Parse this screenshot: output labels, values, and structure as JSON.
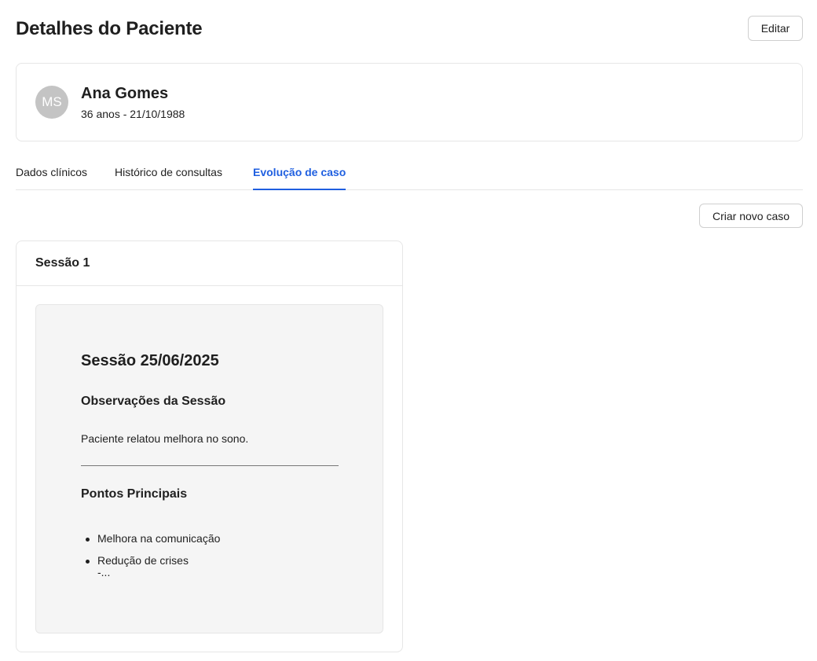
{
  "header": {
    "title": "Detalhes do Paciente",
    "edit_label": "Editar"
  },
  "patient": {
    "initials": "MS",
    "name": "Ana Gomes",
    "subtitle": "36 anos - 21/10/1988"
  },
  "tabs": [
    {
      "label": "Dados clínicos",
      "active": false
    },
    {
      "label": "Histórico de consultas",
      "active": false
    },
    {
      "label": "Evolução de caso",
      "active": true
    }
  ],
  "actions": {
    "new_case_label": "Criar novo caso"
  },
  "session": {
    "card_title": "Sessão 1",
    "doc_title": "Sessão 25/06/2025",
    "observations_heading": "Observações da Sessão",
    "observations_text": "Paciente relatou melhora no sono.",
    "points_heading": "Pontos Principais",
    "points": [
      "Melhora na comunicação",
      "Redução de crises"
    ],
    "points_continuation": "-..."
  },
  "colors": {
    "accent": "#1f5fe0",
    "avatar_bg": "#c4c4c4",
    "doc_bg": "#f5f5f5",
    "border": "#e6e6e6"
  }
}
